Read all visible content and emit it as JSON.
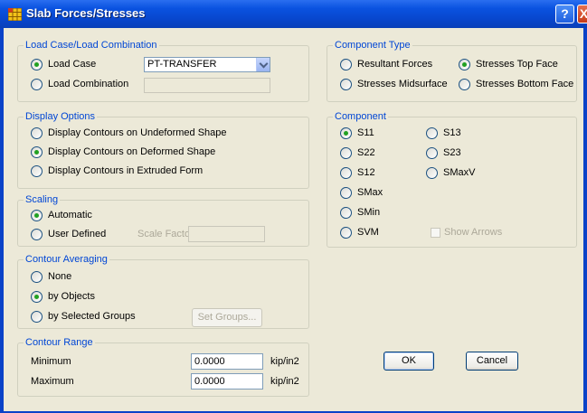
{
  "window": {
    "title": "Slab Forces/Stresses",
    "help_label": "?",
    "close_label": "X"
  },
  "load_case_group": {
    "title": "Load Case/Load Combination",
    "load_case_label": "Load Case",
    "load_case_selected": true,
    "load_case_value": "PT-TRANSFER",
    "load_combination_label": "Load Combination",
    "load_combination_selected": false,
    "load_combination_value": ""
  },
  "display_options_group": {
    "title": "Display Options",
    "options": [
      {
        "label": "Display Contours on Undeformed Shape",
        "selected": false
      },
      {
        "label": "Display Contours on Deformed Shape",
        "selected": true
      },
      {
        "label": "Display Contours in Extruded Form",
        "selected": false
      }
    ]
  },
  "scaling_group": {
    "title": "Scaling",
    "automatic_label": "Automatic",
    "automatic_selected": true,
    "user_defined_label": "User Defined",
    "user_defined_selected": false,
    "scale_factor_label": "Scale Factor",
    "scale_factor_value": ""
  },
  "contour_averaging_group": {
    "title": "Contour Averaging",
    "options": [
      {
        "label": "None",
        "selected": false
      },
      {
        "label": "by Objects",
        "selected": true
      },
      {
        "label": "by Selected Groups",
        "selected": false
      }
    ],
    "set_groups_label": "Set Groups..."
  },
  "contour_range_group": {
    "title": "Contour Range",
    "minimum_label": "Minimum",
    "minimum_value": "0.0000",
    "minimum_unit": "kip/in2",
    "maximum_label": "Maximum",
    "maximum_value": "0.0000",
    "maximum_unit": "kip/in2"
  },
  "component_type_group": {
    "title": "Component Type",
    "options": [
      {
        "label": "Resultant Forces",
        "selected": false
      },
      {
        "label": "Stresses Top Face",
        "selected": true
      },
      {
        "label": "Stresses Midsurface",
        "selected": false
      },
      {
        "label": "Stresses Bottom Face",
        "selected": false
      }
    ]
  },
  "component_group": {
    "title": "Component",
    "options": [
      {
        "label": "S11",
        "selected": true
      },
      {
        "label": "S13",
        "selected": false
      },
      {
        "label": "S22",
        "selected": false
      },
      {
        "label": "S23",
        "selected": false
      },
      {
        "label": "S12",
        "selected": false
      },
      {
        "label": "SMaxV",
        "selected": false
      },
      {
        "label": "SMax",
        "selected": false
      },
      {
        "label": "SMin",
        "selected": false
      },
      {
        "label": "SVM",
        "selected": false
      }
    ],
    "show_arrows_label": "Show Arrows",
    "show_arrows_checked": false
  },
  "buttons": {
    "ok_label": "OK",
    "cancel_label": "Cancel"
  }
}
